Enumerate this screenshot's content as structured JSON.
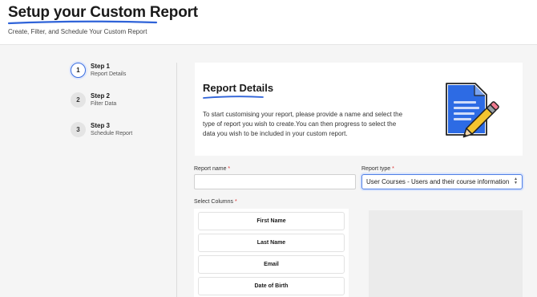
{
  "header": {
    "title": "Setup your Custom Report",
    "subtitle": "Create, Filter, and Schedule Your Custom Report"
  },
  "steps": [
    {
      "number": "1",
      "name": "Step 1",
      "desc": "Report Details",
      "active": true
    },
    {
      "number": "2",
      "name": "Step 2",
      "desc": "Filter Data",
      "active": false
    },
    {
      "number": "3",
      "name": "Step 3",
      "desc": "Schedule Report",
      "active": false
    }
  ],
  "details": {
    "title": "Report Details",
    "description": "To start customising your report, please provide a name and select the type of report you wish to create.You can then progress to select the data you wish to be included in your custom report."
  },
  "form": {
    "report_name_label": "Report name",
    "report_name_value": "",
    "report_type_label": "Report type",
    "report_type_value": "User Courses - Users and their course information",
    "required_mark": "*",
    "select_columns_label": "Select Columns"
  },
  "columns": [
    "First Name",
    "Last Name",
    "Email",
    "Date of Birth"
  ],
  "colors": {
    "accent": "#3b6fe0",
    "underline": "#2f63d8",
    "doc_blue": "#2d6be4",
    "pencil_yellow": "#f4c430"
  },
  "icons": [
    "document-pencil-icon",
    "select-arrows-icon"
  ]
}
